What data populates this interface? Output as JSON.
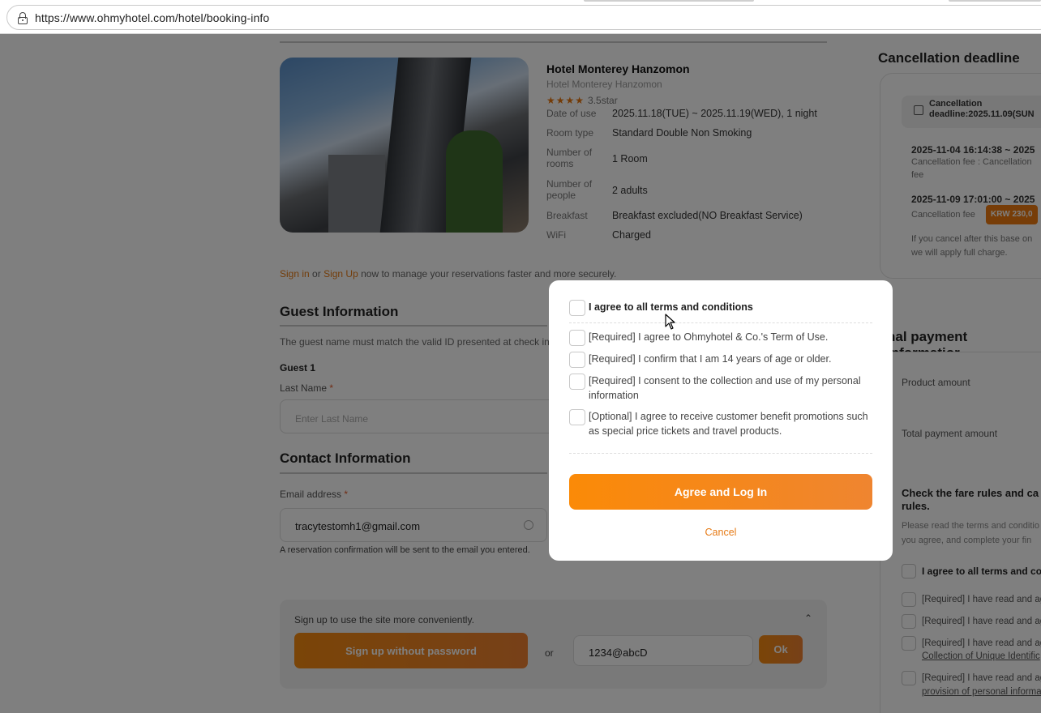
{
  "browser": {
    "url": "https://www.ohmyhotel.com/hotel/booking-info"
  },
  "hotel": {
    "name": "Hotel Monterey Hanzomon",
    "subname": "Hotel Monterey Hanzomon",
    "rating_stars": "★★★★",
    "rating_label": "3.5star",
    "details": [
      {
        "label": "Date of use",
        "value": "2025.11.18(TUE) ~ 2025.11.19(WED), 1 night"
      },
      {
        "label": "Room type",
        "value": "Standard Double Non Smoking"
      },
      {
        "label": "Number of rooms",
        "value": "1 Room"
      },
      {
        "label": "Number of people",
        "value": "2 adults"
      },
      {
        "label": "Breakfast",
        "value": "Breakfast excluded(NO Breakfast Service)"
      },
      {
        "label": "WiFi",
        "value": "Charged"
      }
    ]
  },
  "signin_prompt": {
    "sign_in": "Sign in",
    "or": "or",
    "sign_up": "Sign Up",
    "rest": "now to manage your reservations faster and more securely."
  },
  "guest": {
    "title": "Guest Information",
    "note": "The guest name must match the valid ID presented at check in.",
    "guest_label": "Guest 1",
    "last_name_label": "Last Name",
    "required_mark": "*",
    "last_name_placeholder": "Enter Last Name"
  },
  "contact": {
    "title": "Contact Information",
    "email_label": "Email address",
    "required_mark": "*",
    "email_value": "tracytestomh1@gmail.com",
    "email_note": "A reservation confirmation will be sent to the email you entered."
  },
  "signup_box": {
    "title": "Sign up to use the site more conveniently.",
    "signup_button": "Sign up without password",
    "or": "or",
    "password_value": "1234@abcD",
    "ok_button": "Ok"
  },
  "right_panel": {
    "cancel_title": "Cancellation deadline",
    "cancel_badge": "Cancellation deadline:2025.11.09(SUN",
    "cancel_items": [
      {
        "date": "2025-11-04 16:14:38 ~ 2025",
        "desc": "Cancellation fee : Cancellation",
        "desc2": "fee"
      },
      {
        "date": "2025-11-09 17:01:00 ~ 2025",
        "desc": "Cancellation fee",
        "fee": "KRW 230,0"
      }
    ],
    "cancel_note": "If you cancel after this base on",
    "cancel_note2": "we will apply full charge.",
    "payment_title": "nal payment informatior",
    "product_amount": "Product amount",
    "total_amount": "Total payment amount",
    "fare_title": "Check the fare rules and ca",
    "fare_title2": "rules.",
    "fare_desc": "Please read the terms and conditio",
    "fare_desc2": "you agree, and complete your fin",
    "terms": [
      {
        "label": "I agree to all terms and cond",
        "bold": true
      },
      {
        "label": "[Required] I have read and ag"
      },
      {
        "label": "[Required] I have read and ag"
      },
      {
        "label": "[Required] I have read and ag",
        "sub": "Collection of Unique Identific"
      },
      {
        "label": "[Required] I have read and ag",
        "sub": "provision of personal informa"
      }
    ]
  },
  "modal": {
    "all_terms": "I agree to all terms and conditions",
    "items": [
      "[Required] I agree to Ohmyhotel & Co.'s Term of Use.",
      "[Required] I confirm that I am 14 years of age or older.",
      "[Required] I consent to the collection and use of my personal information",
      "[Optional] I agree to receive customer benefit promotions such as special price tickets and travel products."
    ],
    "agree_button": "Agree and Log In",
    "cancel_button": "Cancel"
  }
}
